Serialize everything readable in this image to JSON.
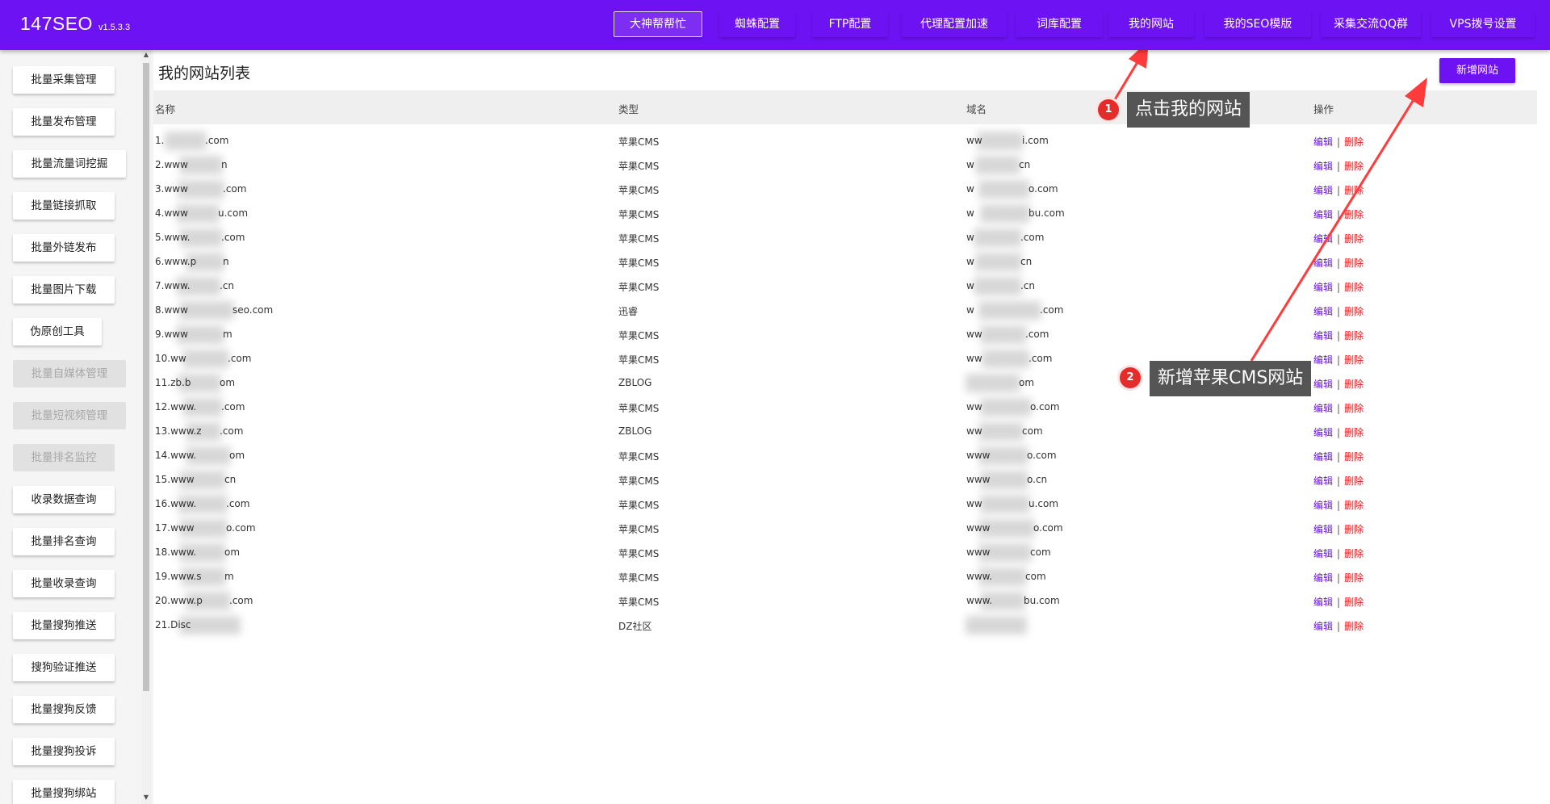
{
  "header": {
    "app_name": "147SEO",
    "version": "v1.5.3.3",
    "nav": [
      {
        "label": "大神帮帮忙",
        "active": true
      },
      {
        "label": "蜘蛛配置",
        "active": false
      },
      {
        "label": "FTP配置",
        "active": false
      },
      {
        "label": "代理配置加速",
        "active": false
      },
      {
        "label": "词库配置",
        "active": false
      },
      {
        "label": "我的网站",
        "active": false
      },
      {
        "label": "我的SEO模版",
        "active": false
      },
      {
        "label": "采集交流QQ群",
        "active": false
      },
      {
        "label": "VPS拨号设置",
        "active": false
      }
    ]
  },
  "sidebar": {
    "items": [
      {
        "label": "批量采集管理",
        "enabled": true
      },
      {
        "label": "批量发布管理",
        "enabled": true
      },
      {
        "label": "批量流量词挖掘",
        "enabled": true
      },
      {
        "label": "批量链接抓取",
        "enabled": true
      },
      {
        "label": "批量外链发布",
        "enabled": true
      },
      {
        "label": "批量图片下载",
        "enabled": true
      },
      {
        "label": "伪原创工具",
        "enabled": true
      },
      {
        "label": "批量自媒体管理",
        "enabled": false
      },
      {
        "label": "批量短视频管理",
        "enabled": false
      },
      {
        "label": "批量排名监控",
        "enabled": false
      },
      {
        "label": "收录数据查询",
        "enabled": true
      },
      {
        "label": "批量排名查询",
        "enabled": true
      },
      {
        "label": "批量收录查询",
        "enabled": true
      },
      {
        "label": "批量搜狗推送",
        "enabled": true
      },
      {
        "label": "搜狗验证推送",
        "enabled": true
      },
      {
        "label": "批量搜狗反馈",
        "enabled": true
      },
      {
        "label": "批量搜狗投诉",
        "enabled": true
      },
      {
        "label": "批量搜狗绑站",
        "enabled": true
      }
    ]
  },
  "main": {
    "title": "我的网站列表",
    "add_button": "新增网站",
    "columns": [
      "名称",
      "类型",
      "域名",
      "操作"
    ],
    "edit_label": "编辑",
    "delete_label": "删除",
    "op_separator": "|",
    "rows": [
      {
        "name": [
          "1.",
          ".com"
        ],
        "type": "苹果CMS",
        "domain": [
          "ww",
          "i.com"
        ]
      },
      {
        "name": [
          "2.www",
          "n"
        ],
        "type": "苹果CMS",
        "domain": [
          "w",
          "cn"
        ]
      },
      {
        "name": [
          "3.www",
          ".com"
        ],
        "type": "苹果CMS",
        "domain": [
          "w",
          "o.com"
        ]
      },
      {
        "name": [
          "4.www",
          "u.com"
        ],
        "type": "苹果CMS",
        "domain": [
          "w",
          "bu.com"
        ]
      },
      {
        "name": [
          "5.www.",
          ".com"
        ],
        "type": "苹果CMS",
        "domain": [
          "w",
          ".com"
        ]
      },
      {
        "name": [
          "6.www.p",
          "n"
        ],
        "type": "苹果CMS",
        "domain": [
          "w",
          "cn"
        ]
      },
      {
        "name": [
          "7.www.",
          ".cn"
        ],
        "type": "苹果CMS",
        "domain": [
          "w",
          ".cn"
        ]
      },
      {
        "name": [
          "8.www",
          "seo.com"
        ],
        "type": "迅睿",
        "domain": [
          "w",
          ".com"
        ]
      },
      {
        "name": [
          "9.www",
          "m"
        ],
        "type": "苹果CMS",
        "domain": [
          "ww",
          ".com"
        ]
      },
      {
        "name": [
          "10.ww",
          ".com"
        ],
        "type": "苹果CMS",
        "domain": [
          "ww",
          ".com"
        ]
      },
      {
        "name": [
          "11.zb.b",
          "om"
        ],
        "type": "ZBLOG",
        "domain": [
          "",
          "om"
        ]
      },
      {
        "name": [
          "12.www.",
          ".com"
        ],
        "type": "苹果CMS",
        "domain": [
          "ww",
          "o.com"
        ]
      },
      {
        "name": [
          "13.www.z",
          ".com"
        ],
        "type": "ZBLOG",
        "domain": [
          "ww",
          "com"
        ]
      },
      {
        "name": [
          "14.www.",
          "om"
        ],
        "type": "苹果CMS",
        "domain": [
          "www",
          "o.com"
        ]
      },
      {
        "name": [
          "15.www",
          "cn"
        ],
        "type": "苹果CMS",
        "domain": [
          "www",
          "o.cn"
        ]
      },
      {
        "name": [
          "16.www.",
          ".com"
        ],
        "type": "苹果CMS",
        "domain": [
          "ww",
          "u.com"
        ]
      },
      {
        "name": [
          "17.www",
          "o.com"
        ],
        "type": "苹果CMS",
        "domain": [
          "www",
          "o.com"
        ]
      },
      {
        "name": [
          "18.www.",
          "om"
        ],
        "type": "苹果CMS",
        "domain": [
          "www",
          "com"
        ]
      },
      {
        "name": [
          "19.www.s",
          "m"
        ],
        "type": "苹果CMS",
        "domain": [
          "www.",
          "com"
        ]
      },
      {
        "name": [
          "20.www.p",
          ".com"
        ],
        "type": "苹果CMS",
        "domain": [
          "www.",
          "bu.com"
        ]
      },
      {
        "name": [
          "21.Disc",
          ""
        ],
        "type": "DZ社区",
        "domain": [
          "",
          ""
        ]
      }
    ]
  },
  "annotations": [
    {
      "number": "1",
      "text": "点击我的网站"
    },
    {
      "number": "2",
      "text": "新增苹果CMS网站"
    }
  ],
  "colors": {
    "brand": "#6d12f2",
    "annotation_red": "#e62b2b",
    "delete_red": "#e01a1a"
  }
}
